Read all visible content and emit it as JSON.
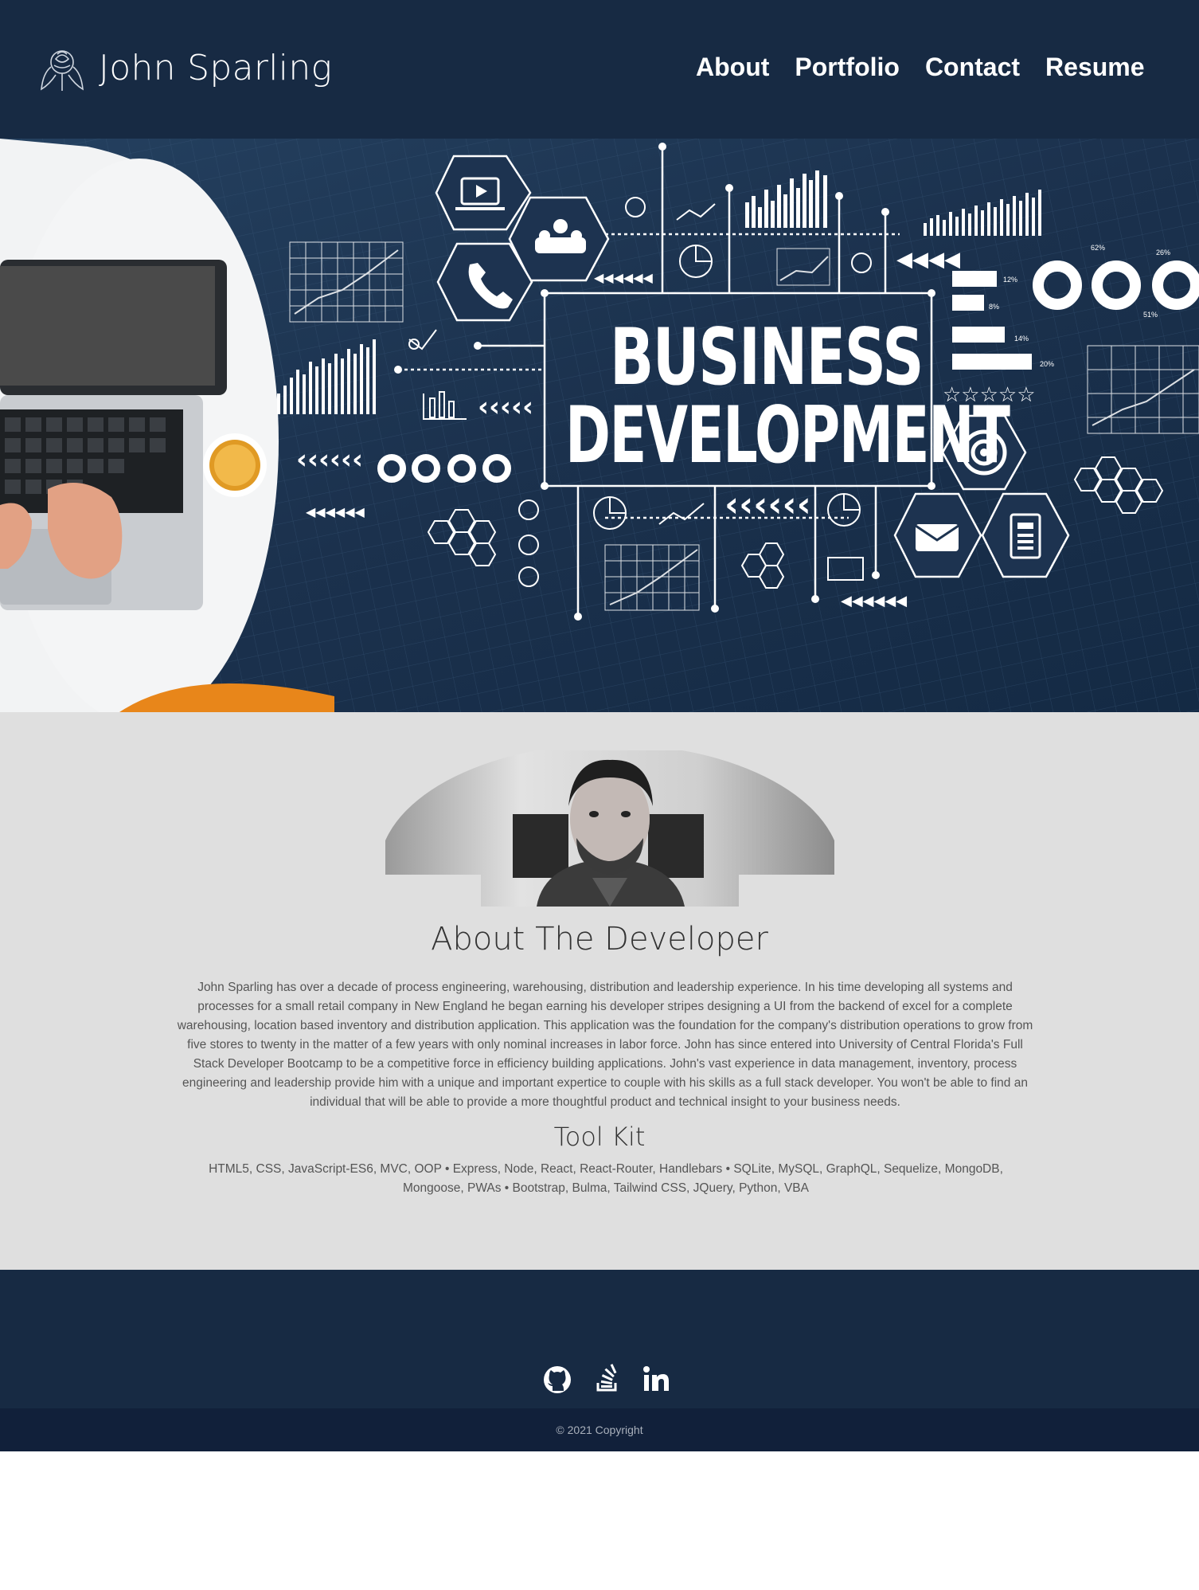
{
  "header": {
    "brand": "John Sparling",
    "nav": [
      "About",
      "Portfolio",
      "Contact",
      "Resume"
    ]
  },
  "hero": {
    "line1": "BUSINESS",
    "line2": "DEVELOPMENT",
    "percent_labels": [
      "62%",
      "26%",
      "51%",
      "12%",
      "8%",
      "14%",
      "20%"
    ]
  },
  "about": {
    "title": "About The Developer",
    "text": "John Sparling has over a decade of process engineering, warehousing, distribution and leadership experience. In his time developing all systems and processes for a small retail company in New England he began earning his developer stripes designing a UI from the backend of excel for a complete warehousing, location based inventory and distribution application. This application was the foundation for the company's distribution operations to grow from five stores to twenty in the matter of a few years with only nominal increases in labor force. John has since entered into University of Central Florida's Full Stack Developer Bootcamp to be a competitive force in efficiency building applications. John's vast experience in data management, inventory, process engineering and leadership provide him with a unique and important expertice to couple with his skills as a full stack developer. You won't be able to find an individual that will be able to provide a more thoughtful product and technical insight to your business needs.",
    "toolkit_title": "Tool Kit",
    "toolkit_text": "HTML5, CSS, JavaScript-ES6, MVC, OOP • Express, Node, React, React-Router, Handlebars • SQLite, MySQL, GraphQL, Sequelize, MongoDB, Mongoose, PWAs • Bootstrap, Bulma, Tailwind CSS, JQuery, Python, VBA"
  },
  "footer": {
    "icons": [
      "github-icon",
      "stackoverflow-icon",
      "linkedin-icon"
    ],
    "copyright": "© 2021 Copyright"
  },
  "colors": {
    "header_bg": "#172a43",
    "about_bg": "#dfdfdf",
    "copyright_bg": "#11203a"
  }
}
